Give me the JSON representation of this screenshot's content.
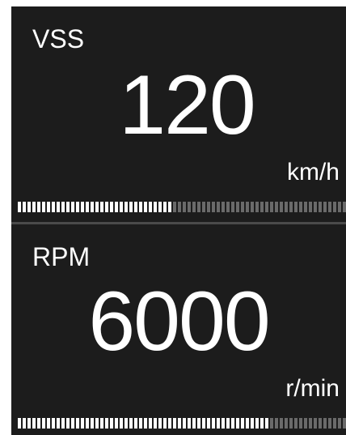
{
  "vss": {
    "label": "VSS",
    "value": "120",
    "unit": "km/h",
    "level": 0.47
  },
  "rpm": {
    "label": "RPM",
    "value": "6000",
    "unit": "r/min",
    "level": 0.77
  },
  "colors": {
    "background": "#1c1c1c",
    "text": "#ffffff",
    "segment_on": "#ffffff",
    "segment_off": "#6a6a6a",
    "divider": "#4a4a4a"
  }
}
